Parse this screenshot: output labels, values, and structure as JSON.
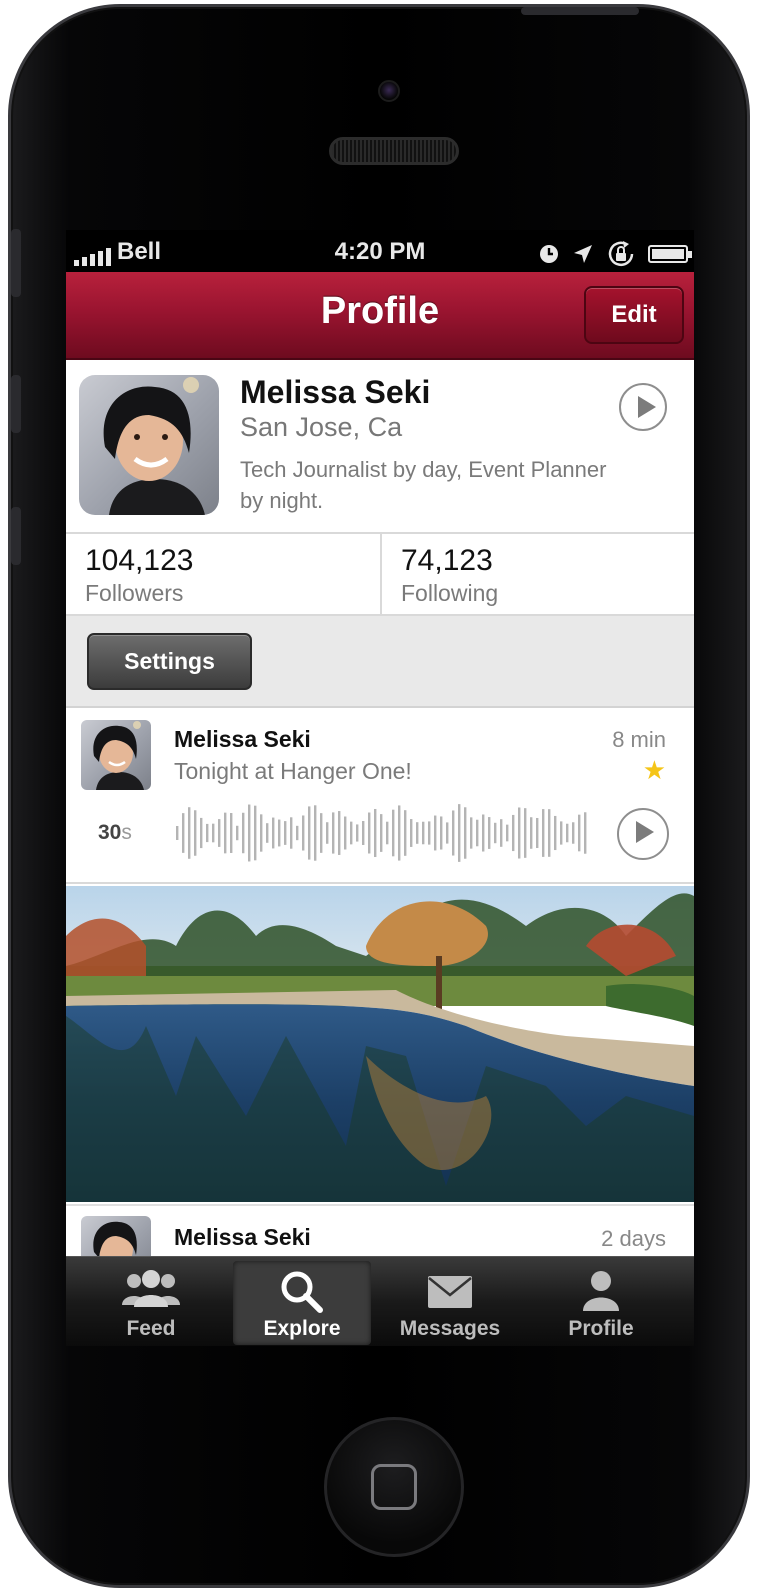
{
  "status_bar": {
    "carrier": "Bell",
    "time": "4:20 PM"
  },
  "nav": {
    "title": "Profile",
    "edit_label": "Edit"
  },
  "profile": {
    "name": "Melissa Seki",
    "location": "San Jose, Ca",
    "bio": "Tech Journalist by day, Event Planner by night.",
    "play_icon": "play-icon"
  },
  "stats": [
    {
      "value": "104,123",
      "label": "Followers"
    },
    {
      "value": "74,123",
      "label": "Following"
    }
  ],
  "settings_label": "Settings",
  "posts": [
    {
      "author": "Melissa Seki",
      "text": "Tonight at Hanger One!",
      "time": "8 min",
      "starred": true,
      "duration_value": "30",
      "duration_unit": "s"
    },
    {
      "author": "Melissa Seki",
      "time": "2 days"
    }
  ],
  "tabs": [
    {
      "label": "Feed",
      "icon": "people-icon"
    },
    {
      "label": "Explore",
      "icon": "search-icon",
      "active": true
    },
    {
      "label": "Messages",
      "icon": "envelope-icon"
    },
    {
      "label": "Profile",
      "icon": "person-icon"
    }
  ],
  "colors": {
    "accent": "#9a1430",
    "star": "#f5c518"
  }
}
